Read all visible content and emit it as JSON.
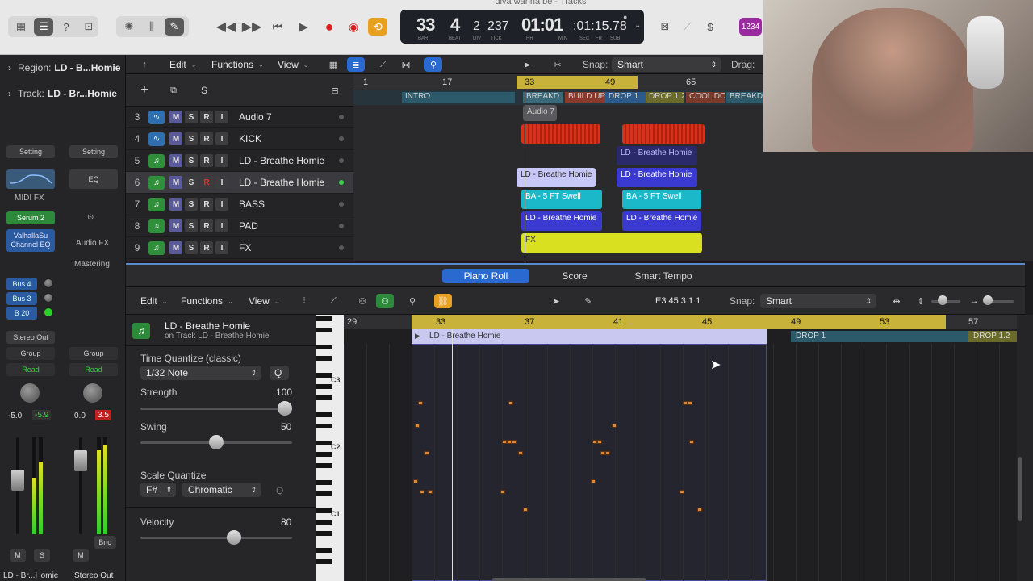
{
  "window_title": "diva wanna be - Tracks",
  "lcd": {
    "bar": "33",
    "beat": "4",
    "div": "2",
    "tick": "237",
    "time_main": "01:01",
    "time_sub": ":01:15.78",
    "labels": [
      "BAR",
      "BEAT",
      "DIV",
      "TICK",
      "HR",
      "MIN",
      "SEC",
      "FR",
      "SUB"
    ]
  },
  "top_right_badge": "1234",
  "toolbar": {
    "edit": "Edit",
    "functions": "Functions",
    "view": "View",
    "snap_label": "Snap:",
    "snap_value": "Smart",
    "drag_label": "Drag:"
  },
  "inspector": {
    "region_label": "Region:",
    "region_name": "LD - B...Homie",
    "track_label": "Track:",
    "track_name": "LD - Br...Homie",
    "setting_left": "Setting",
    "setting_right": "Setting",
    "eq": "EQ",
    "midi_fx": "MIDI FX",
    "instrument": "Serum 2",
    "plugin": "ValhallaSu Channel EQ",
    "audio_fx": "Audio FX",
    "mastering": "Mastering",
    "sends": [
      "Bus 4",
      "Bus 3",
      "B 20"
    ],
    "output": "Stereo Out",
    "group_left": "Group",
    "group_right": "Group",
    "read_left": "Read",
    "read_right": "Read",
    "vol_left": "-5.0",
    "peak_left": "-5.9",
    "vol_right": "0.0",
    "peak_right": "3.5",
    "m": "M",
    "s": "S",
    "bnc": "Bnc",
    "strip_left_name": "LD - Br...Homie",
    "strip_right_name": "Stereo Out"
  },
  "track_header_icons": {
    "add": "+",
    "s": "S"
  },
  "tracks": [
    {
      "num": "3",
      "name": "Audio 7",
      "r": "R",
      "color": "#2f6fb0"
    },
    {
      "num": "4",
      "name": "KICK",
      "r": "R",
      "color": "#2f6fb0"
    },
    {
      "num": "5",
      "name": "LD - Breathe Homie",
      "r": "R",
      "color": "#2f8f3a"
    },
    {
      "num": "6",
      "name": "LD - Breathe Homie",
      "r": "R",
      "color": "#2f8f3a"
    },
    {
      "num": "7",
      "name": "BASS",
      "r": "R",
      "color": "#2f8f3a"
    },
    {
      "num": "8",
      "name": "PAD",
      "r": "R",
      "color": "#2f8f3a"
    },
    {
      "num": "9",
      "name": "FX",
      "r": "R",
      "color": "#2f8f3a"
    }
  ],
  "track_buttons": {
    "m": "M",
    "s": "S",
    "i": "I"
  },
  "ruler": [
    "1",
    "17",
    "33",
    "49",
    "65"
  ],
  "markers": [
    "INTRO",
    "BREAKD",
    "BUILD UP",
    "DROP 1",
    "DROP 1.2",
    "COOL DO",
    "BREAKDO"
  ],
  "regions": {
    "audio7": "Audio 7",
    "ld5": "LD - Breathe Homie",
    "ld6a": "LD - Breathe Homie",
    "ld6b": "LD - Breathe Homie",
    "bass_a": "BA - 5 FT Swell",
    "bass_b": "BA - 5 FT Swell",
    "pad_a": "LD - Breathe Homie",
    "pad_b": "LD - Breathe Homie",
    "fx": "FX"
  },
  "editor_tabs": {
    "piano_roll": "Piano Roll",
    "score": "Score",
    "smart_tempo": "Smart Tempo"
  },
  "editor_bar": {
    "edit": "Edit",
    "functions": "Functions",
    "view": "View",
    "position": "E3  45 3 1 1",
    "snap_label": "Snap:",
    "snap_value": "Smart"
  },
  "piano_roll": {
    "region_name": "LD - Breathe Homie",
    "region_sub": "on Track LD - Breathe Homie",
    "tq_label": "Time Quantize (classic)",
    "tq_value": "1/32 Note",
    "q": "Q",
    "strength_label": "Strength",
    "strength_value": "100",
    "strength_level": 1.0,
    "swing_label": "Swing",
    "swing_value": "50",
    "swing_level": 0.5,
    "scale_label": "Scale Quantize",
    "scale_key": "F#",
    "scale_type": "Chromatic",
    "velocity_label": "Velocity",
    "velocity_value": "80",
    "velocity_level": 0.63,
    "key_labels": [
      "C3",
      "C2",
      "C1"
    ],
    "ruler": [
      "29",
      "33",
      "37",
      "41",
      "45",
      "49",
      "53",
      "57"
    ],
    "region_label": "LD - Breathe Homie",
    "marker1": "DROP 1",
    "marker2": "DROP 1.2"
  }
}
